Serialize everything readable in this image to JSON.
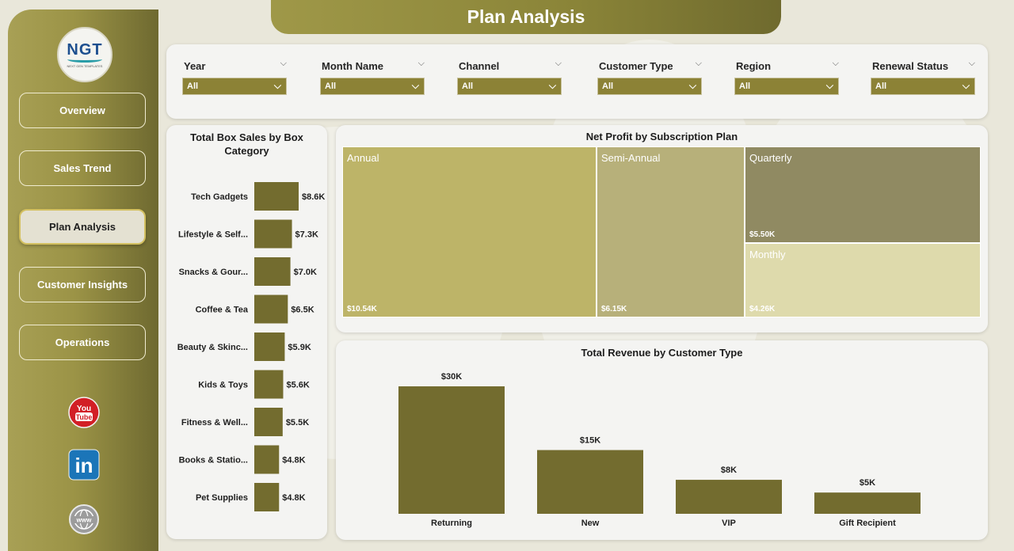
{
  "page_title": "Plan Analysis",
  "logo": {
    "text": "NGT",
    "subtext": "NEXT GEN TEMPLATES"
  },
  "nav": [
    {
      "label": "Overview",
      "active": false
    },
    {
      "label": "Sales Trend",
      "active": false
    },
    {
      "label": "Plan Analysis",
      "active": true
    },
    {
      "label": "Customer Insights",
      "active": false
    },
    {
      "label": "Operations",
      "active": false
    }
  ],
  "social": {
    "youtube_text_1": "You",
    "youtube_text_2": "Tube",
    "linkedin_text": "in",
    "web_text": "www"
  },
  "filters": [
    {
      "label": "Year",
      "value": "All"
    },
    {
      "label": "Month Name",
      "value": "All"
    },
    {
      "label": "Channel",
      "value": "All"
    },
    {
      "label": "Customer Type",
      "value": "All"
    },
    {
      "label": "Region",
      "value": "All"
    },
    {
      "label": "Renewal Status",
      "value": "All"
    }
  ],
  "colors": {
    "bar": "#736c2f",
    "accent": "#8c8236"
  },
  "chart_data": [
    {
      "type": "bar",
      "orientation": "horizontal",
      "title": "Total Box Sales by Box Category",
      "categories": [
        "Tech Gadgets",
        "Lifestyle & Self...",
        "Snacks & Gour...",
        "Coffee & Tea",
        "Beauty & Skinc...",
        "Kids & Toys",
        "Fitness & Well...",
        "Books & Statio...",
        "Pet Supplies"
      ],
      "values": [
        8.6,
        7.3,
        7.0,
        6.5,
        5.9,
        5.6,
        5.5,
        4.8,
        4.8
      ],
      "value_labels": [
        "$8.6K",
        "$7.3K",
        "$7.0K",
        "$6.5K",
        "$5.9K",
        "$5.6K",
        "$5.5K",
        "$4.8K",
        "$4.8K"
      ],
      "unit": "K"
    },
    {
      "type": "treemap",
      "title": "Net Profit by Subscription Plan",
      "items": [
        {
          "name": "Annual",
          "value": 10.54,
          "label": "$10.54K",
          "color": "#bdb468"
        },
        {
          "name": "Semi-Annual",
          "value": 6.15,
          "label": "$6.15K",
          "color": "#b7b07a"
        },
        {
          "name": "Quarterly",
          "value": 5.5,
          "label": "$5.50K",
          "color": "#908a62"
        },
        {
          "name": "Monthly",
          "value": 4.26,
          "label": "$4.26K",
          "color": "#dedaac"
        }
      ]
    },
    {
      "type": "bar",
      "orientation": "vertical",
      "title": "Total Revenue by Customer Type",
      "categories": [
        "Returning",
        "New",
        "VIP",
        "Gift Recipient"
      ],
      "values": [
        30,
        15,
        8,
        5
      ],
      "value_labels": [
        "$30K",
        "$15K",
        "$8K",
        "$5K"
      ],
      "unit": "K"
    }
  ]
}
